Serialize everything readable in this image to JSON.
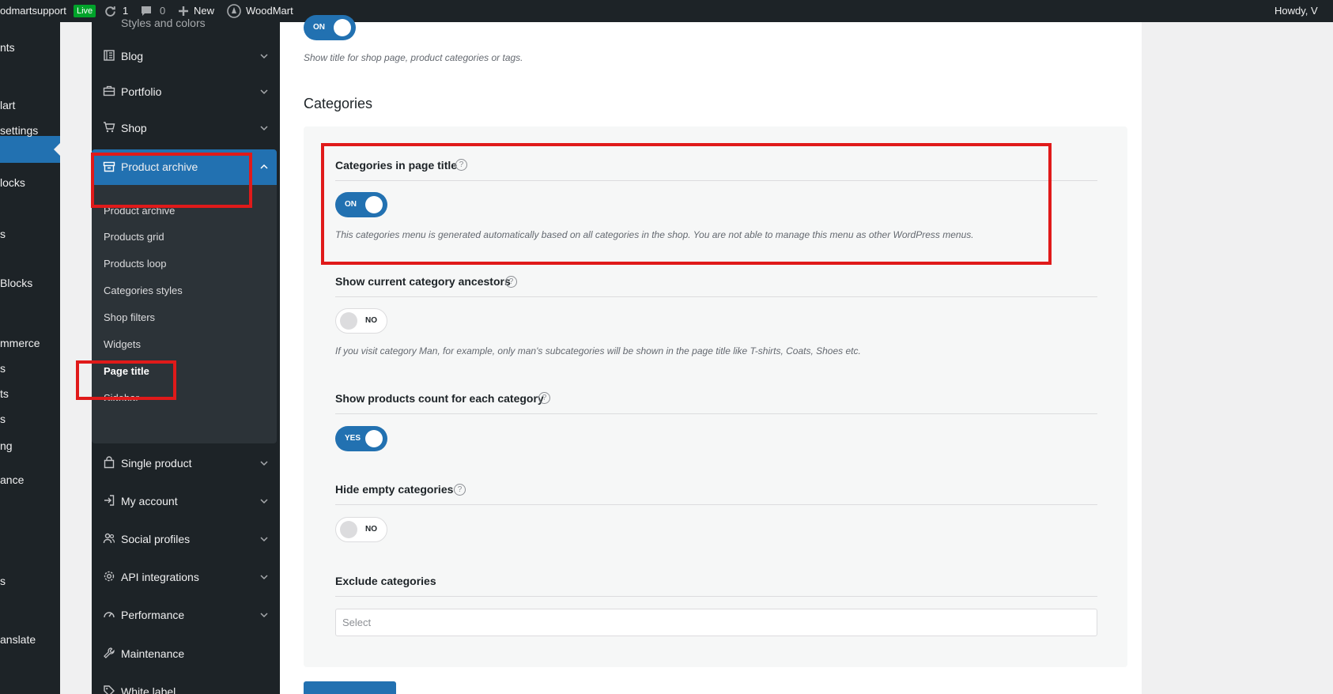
{
  "admin_bar": {
    "site_name": "odmartsupport",
    "live_badge": "Live",
    "updates_count": "1",
    "comments_count": "0",
    "new_label": "New",
    "woodmart_label": "WoodMart",
    "howdy": "Howdy, V"
  },
  "wp_menu": {
    "items": [
      "nts",
      "lart",
      "settings",
      "locks",
      "s",
      "Blocks",
      "mmerce",
      "s",
      "ts",
      "s",
      "ng",
      "ance",
      "s",
      "anslate"
    ]
  },
  "theme_menu": {
    "partial_top": "Styles and colors",
    "items": [
      {
        "label": "Blog",
        "icon": "blog-icon"
      },
      {
        "label": "Portfolio",
        "icon": "briefcase-icon"
      },
      {
        "label": "Shop",
        "icon": "cart-icon"
      },
      {
        "label": "Product archive",
        "icon": "archive-icon"
      },
      {
        "label": "Single product",
        "icon": "bag-icon"
      },
      {
        "label": "My account",
        "icon": "login-icon"
      },
      {
        "label": "Social profiles",
        "icon": "users-icon"
      },
      {
        "label": "API integrations",
        "icon": "gear-icon"
      },
      {
        "label": "Performance",
        "icon": "gauge-icon"
      },
      {
        "label": "Maintenance",
        "icon": "wrench-icon"
      },
      {
        "label": "White label",
        "icon": "tag-icon"
      }
    ],
    "sub_items": [
      "Product archive",
      "Products grid",
      "Products loop",
      "Categories styles",
      "Shop filters",
      "Widgets",
      "Page title",
      "Sidebar"
    ]
  },
  "content": {
    "top_toggle": "ON",
    "top_hint": "Show title for shop page, product categories or tags.",
    "section_title": "Categories",
    "fields": [
      {
        "title": "Categories in page title",
        "toggle": "ON",
        "hint": "This categories menu is generated automatically based on all categories in the shop. You are not able to manage this menu as other WordPress menus."
      },
      {
        "title": "Show current category ancestors",
        "toggle": "NO",
        "hint": "If you visit category Man, for example, only man's subcategories will be shown in the page title like T-shirts, Coats, Shoes etc."
      },
      {
        "title": "Show products count for each category",
        "toggle": "YES"
      },
      {
        "title": "Hide empty categories",
        "toggle": "NO"
      },
      {
        "title": "Exclude categories"
      }
    ],
    "help_glyph": "?",
    "select_placeholder": "Select"
  },
  "colors": {
    "accent": "#2271b1",
    "highlight": "#e01a1a",
    "admin_dark": "#1d2327"
  }
}
